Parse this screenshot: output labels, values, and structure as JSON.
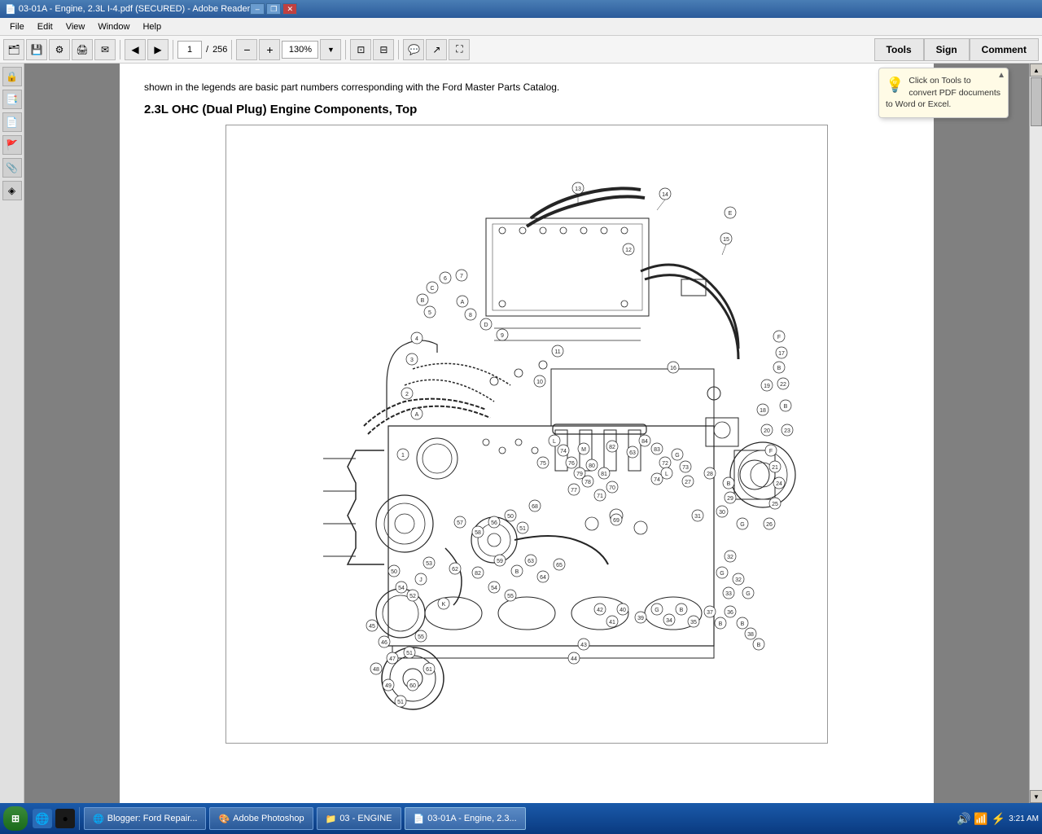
{
  "titlebar": {
    "title": "03-01A - Engine, 2.3L I-4.pdf (SECURED) - Adobe Reader",
    "minimize": "–",
    "restore": "❐",
    "close": "✕"
  },
  "menubar": {
    "items": [
      "File",
      "Edit",
      "View",
      "Window",
      "Help"
    ]
  },
  "toolbar": {
    "page_current": "1",
    "page_total": "256",
    "zoom": "130%",
    "tools_label": "Tools",
    "sign_label": "Sign",
    "comment_label": "Comment"
  },
  "pdf": {
    "text_top": "shown in the legends are basic part numbers corresponding with the Ford Master Parts Catalog.",
    "heading": "2.3L OHC (Dual Plug) Engine Components, Top"
  },
  "tooltip": {
    "text": "Click on Tools to convert PDF documents to Word or Excel."
  },
  "taskbar": {
    "start_label": "⊞",
    "apps": [
      {
        "id": "blogger",
        "label": "Blogger: Ford Repair...",
        "icon": "🌐"
      },
      {
        "id": "photoshop",
        "label": "Adobe Photoshop",
        "icon": "🎨"
      },
      {
        "id": "engine-folder",
        "label": "03 - ENGINE",
        "icon": "📁"
      },
      {
        "id": "adobe-reader",
        "label": "03-01A - Engine, 2.3...",
        "icon": "📄",
        "active": true
      }
    ],
    "time": "3:21 AM"
  }
}
